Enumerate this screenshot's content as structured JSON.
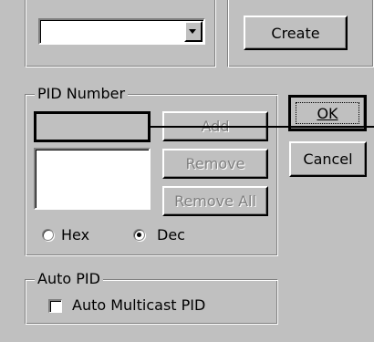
{
  "top": {
    "combo_value": "",
    "create_label": "Create"
  },
  "pid_group": {
    "title": "PID Number",
    "input_value": "",
    "add_label": "Add",
    "remove_label": "Remove",
    "remove_all_label": "Remove All",
    "list_items": [],
    "radio_hex_label": "Hex",
    "radio_dec_label": "Dec",
    "selected_radio": "Dec"
  },
  "dialog": {
    "ok_label": "OK",
    "cancel_label": "Cancel"
  },
  "auto_pid_group": {
    "title": "Auto PID",
    "checkbox_label": "Auto Multicast PID",
    "checkbox_checked": false
  },
  "colors": {
    "dialog_bg": "#c0c0c0",
    "disabled_text": "#808080"
  },
  "icons": {
    "combo_arrow": "chevron-down-icon"
  }
}
